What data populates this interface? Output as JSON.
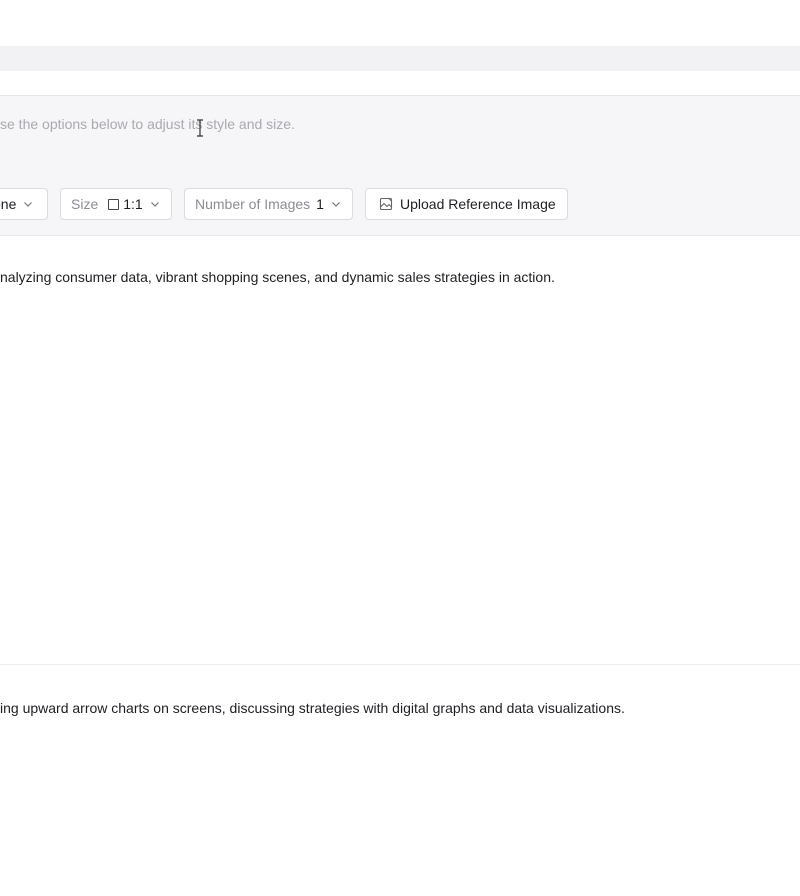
{
  "prompt": {
    "placeholder": "se the options below to adjust its style and size."
  },
  "options": {
    "style_value": "one",
    "size_label": "Size",
    "size_value": "1:1",
    "count_label": "Number of Images",
    "count_value": "1",
    "upload_label": "Upload Reference Image"
  },
  "results": [
    {
      "prompt_text": "nalyzing consumer data, vibrant shopping scenes, and dynamic sales strategies in action."
    },
    {
      "prompt_text": "ing upward arrow charts on screens, discussing strategies with digital graphs and data visualizations."
    }
  ],
  "icons": {
    "chevron": "chevron-down-icon",
    "size": "square-icon",
    "upload": "image-upload-icon",
    "cursor": "text-cursor-icon"
  },
  "colors": {
    "panel_bg": "#f6f6f8",
    "strip_bg": "#f2f2f4",
    "border": "#dcdce0",
    "placeholder": "#a9a9b0"
  }
}
